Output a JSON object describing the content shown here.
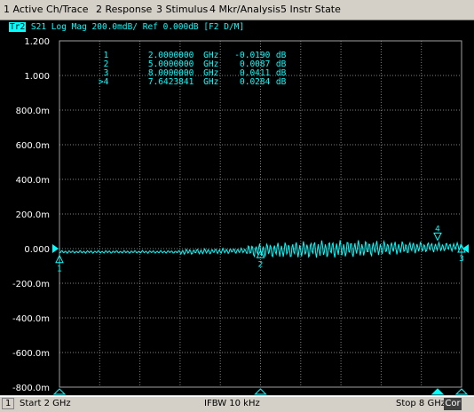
{
  "menu": {
    "items": [
      {
        "label": "1 Active Ch/Trace"
      },
      {
        "label": "2 Response"
      },
      {
        "label": "3 Stimulus"
      },
      {
        "label": "4 Mkr/Analysis"
      },
      {
        "label": "5 Instr State"
      }
    ]
  },
  "trace": {
    "tab": "Tr2",
    "header": "S21 Log Mag 200.0mdB/ Ref 0.000dB [F2 D/M]"
  },
  "markers": [
    {
      "num": "1",
      "freq": "2.0000000",
      "unit": "GHz",
      "value": "-0.0190",
      "vunit": "dB"
    },
    {
      "num": "2",
      "freq": "5.0000000",
      "unit": "GHz",
      "value": "0.0087",
      "vunit": "dB"
    },
    {
      "num": "3",
      "freq": "8.0000000",
      "unit": "GHz",
      "value": "0.0411",
      "vunit": "dB"
    },
    {
      "num": ">4",
      "freq": "7.6423841",
      "unit": "GHz",
      "value": "0.0284",
      "vunit": "dB"
    }
  ],
  "y_axis": {
    "ticks": [
      "1.200",
      "1.000",
      "800.0m",
      "600.0m",
      "400.0m",
      "200.0m",
      "0.000",
      "-200.0m",
      "-400.0m",
      "-600.0m",
      "-800.0m"
    ]
  },
  "status": {
    "channel": "1",
    "start": "Start 2 GHz",
    "ifbw": "IFBW 10 kHz",
    "stop": "Stop 8 GHz",
    "cor": "Cor"
  },
  "colors": {
    "trace": "#00ffff",
    "background": "#000000",
    "grid": "#808080"
  },
  "chart_data": {
    "type": "line",
    "x_unit": "GHz",
    "y_unit": "dB",
    "xlim": [
      2,
      8
    ],
    "ylim": [
      -0.8,
      1.2
    ],
    "y_divisions": 10,
    "x_divisions": 10,
    "grid": true,
    "markers": [
      {
        "label": "1",
        "x": 2.0,
        "y": -0.019
      },
      {
        "label": "2",
        "x": 5.0,
        "y": 0.0087
      },
      {
        "label": "3",
        "x": 8.0,
        "y": 0.0411
      },
      {
        "label": "4",
        "x": 7.6423841,
        "y": 0.0284
      }
    ]
  }
}
